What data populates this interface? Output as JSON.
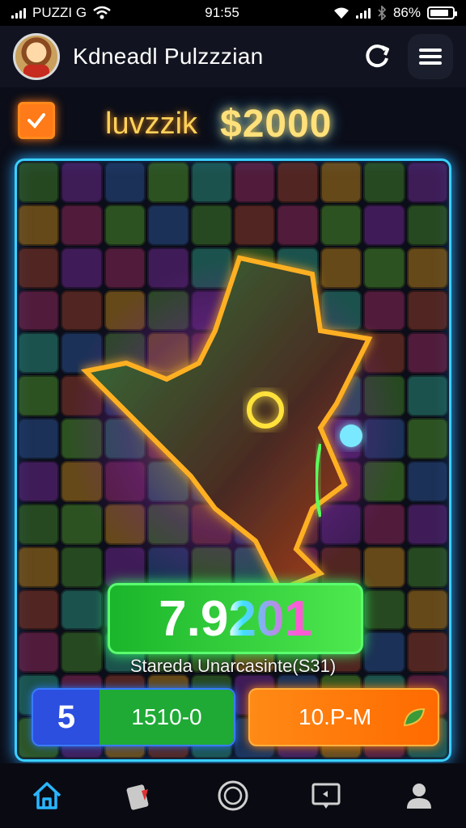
{
  "status_bar": {
    "carrier": "PUZZI G",
    "time": "91:55",
    "battery": "86%"
  },
  "header": {
    "title": "Kdneadl Pulzzzian",
    "avatar_icon": "player-avatar",
    "refresh_icon": "refresh-icon",
    "menu_icon": "hamburger-menu-icon"
  },
  "score": {
    "label": "luvzzik",
    "value": "$2000"
  },
  "board": {
    "main_score": "7.9201",
    "subtitle": "Stareda Unarcasinte(S31)",
    "tile_colors": [
      "#3f7b2a",
      "#8b2a5a",
      "#2a4f8b",
      "#b07a1a",
      "#2a8b7a",
      "#6a2a8b",
      "#8b3a2a",
      "#4a8b2a"
    ]
  },
  "stats": {
    "level": "5",
    "points": "1510-0",
    "time": "10.P-M"
  },
  "nav": {
    "items": [
      "home-icon",
      "cards-icon",
      "circle-icon",
      "chat-icon",
      "profile-icon"
    ]
  },
  "colors": {
    "accent_blue": "#3ad0ff",
    "accent_green": "#4ee84f",
    "accent_orange": "#ff8a16"
  }
}
